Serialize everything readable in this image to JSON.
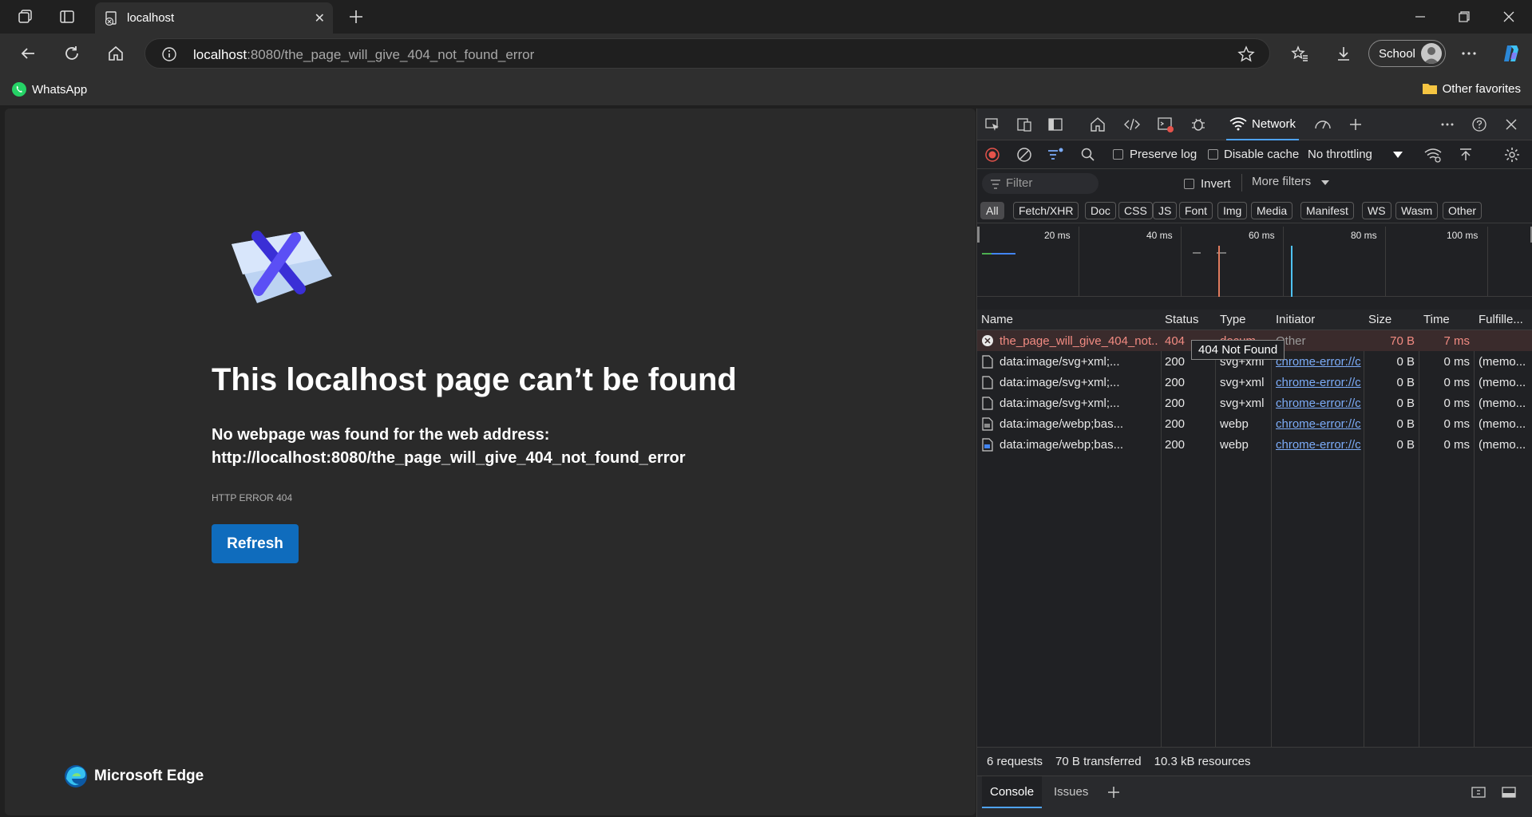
{
  "browser": {
    "tab_title": "localhost",
    "url_host": "localhost",
    "url_rest": ":8080/the_page_will_give_404_not_found_error",
    "profile_label": "School",
    "favorites": [
      "WhatsApp"
    ],
    "other_favorites": "Other favorites"
  },
  "page": {
    "title": "This localhost page can’t be found",
    "message": "No webpage was found for the web address:",
    "url": "http://localhost:8080/the_page_will_give_404_not_found_error",
    "error_code": "HTTP ERROR 404",
    "refresh_label": "Refresh",
    "brand": "Microsoft Edge"
  },
  "devtools": {
    "active_tab": "Network",
    "preserve_log": "Preserve log",
    "disable_cache": "Disable cache",
    "throttling": "No throttling",
    "filter_placeholder": "Filter",
    "invert": "Invert",
    "more_filters": "More filters",
    "type_filters": [
      "All",
      "Fetch/XHR",
      "Doc",
      "CSS",
      "JS",
      "Font",
      "Img",
      "Media",
      "Manifest",
      "WS",
      "Wasm",
      "Other"
    ],
    "timeline_labels": [
      "20 ms",
      "40 ms",
      "60 ms",
      "80 ms",
      "100 ms"
    ],
    "columns": [
      "Name",
      "Status",
      "Type",
      "Initiator",
      "Size",
      "Time",
      "Fulfille..."
    ],
    "rows": [
      {
        "name": "the_page_will_give_404_not...",
        "status": "404",
        "type": "docum...",
        "initiator": "Other",
        "size": "70 B",
        "time": "7 ms",
        "fulfilled": ""
      },
      {
        "name": "data:image/svg+xml;...",
        "status": "200",
        "type": "svg+xml",
        "initiator": "chrome-error://c",
        "size": "0 B",
        "time": "0 ms",
        "fulfilled": "(memo..."
      },
      {
        "name": "data:image/svg+xml;...",
        "status": "200",
        "type": "svg+xml",
        "initiator": "chrome-error://c",
        "size": "0 B",
        "time": "0 ms",
        "fulfilled": "(memo..."
      },
      {
        "name": "data:image/svg+xml;...",
        "status": "200",
        "type": "svg+xml",
        "initiator": "chrome-error://c",
        "size": "0 B",
        "time": "0 ms",
        "fulfilled": "(memo..."
      },
      {
        "name": "data:image/webp;bas...",
        "status": "200",
        "type": "webp",
        "initiator": "chrome-error://c",
        "size": "0 B",
        "time": "0 ms",
        "fulfilled": "(memo..."
      },
      {
        "name": "data:image/webp;bas...",
        "status": "200",
        "type": "webp",
        "initiator": "chrome-error://c",
        "size": "0 B",
        "time": "0 ms",
        "fulfilled": "(memo..."
      }
    ],
    "tooltip": "404 Not Found",
    "summary": {
      "requests": "6 requests",
      "transferred": "70 B transferred",
      "resources": "10.3 kB resources"
    },
    "drawer_tabs": [
      "Console",
      "Issues"
    ]
  }
}
